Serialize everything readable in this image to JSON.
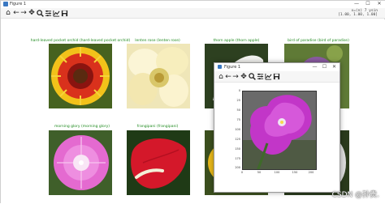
{
  "window": {
    "title": "Figure 1",
    "controls": [
      "—",
      "☐",
      "✕"
    ]
  },
  "toolbar": {
    "icons": [
      "home-icon",
      "back-icon",
      "forward-icon",
      "pan-icon",
      "zoom-icon",
      "configure-subplots-icon",
      "edit-axis-icon",
      "save-icon"
    ],
    "coordinates_line1": "x=(n) 7 ysin",
    "coordinates_line2": "[1.00, 1.00, 1.00]"
  },
  "grid": {
    "captions": [
      "hard-leaved pocket orchid (hard-leaved pocket orchid)",
      "lenten rose (lenten rose)",
      "thorn apple (thorn apple)",
      "bird of paradise (bird of paradise)",
      "morning glory (morning glory)",
      "frangipani (frangipani)"
    ]
  },
  "popup": {
    "title": "Figure 1",
    "controls": [
      "—",
      "☐",
      "✕"
    ],
    "yticks": [
      "0",
      "25",
      "50",
      "75",
      "100",
      "125",
      "150",
      "175",
      "200"
    ],
    "xticks": [
      "0",
      "50",
      "100",
      "150",
      "200"
    ]
  },
  "watermark": "CSDN @孙贵."
}
